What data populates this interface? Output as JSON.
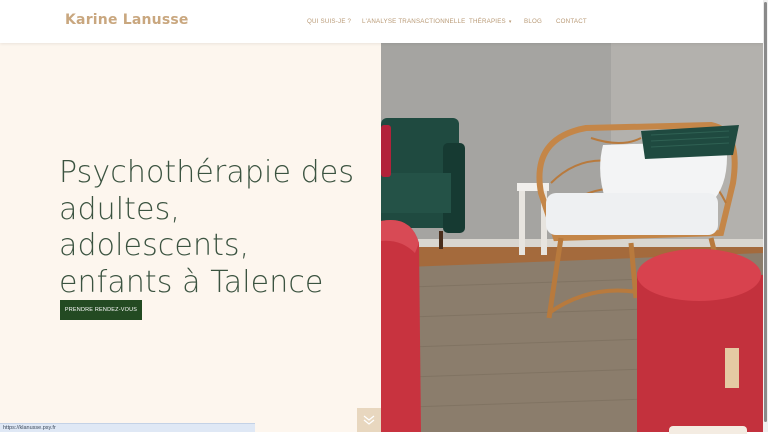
{
  "site": {
    "logo": "Karine Lanusse"
  },
  "nav": {
    "items": [
      {
        "label": "Qui suis-je ?"
      },
      {
        "label": "L'Analyse Transactionnelle"
      },
      {
        "label": "Thérapies"
      },
      {
        "label": "Blog"
      },
      {
        "label": "Contact"
      }
    ]
  },
  "hero": {
    "title": "Psychothérapie des adultes, adolescents, enfants à Talence",
    "cta_label": "Prendre rendez-vous"
  },
  "status_bar": {
    "url": "https://klanusse.psy.fr"
  },
  "colors": {
    "brand": "#c9a77f",
    "cta": "#234a22",
    "hero_bg": "#fdf6ee",
    "title": "#3b5340"
  },
  "icons": {
    "scroll_down": "chevron-double-down-icon",
    "dropdown": "chevron-down-icon"
  }
}
